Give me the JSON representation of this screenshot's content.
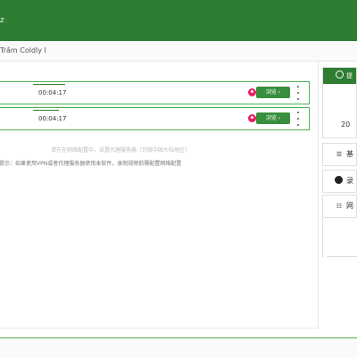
{
  "header": {
    "title_fragment": "z"
  },
  "breadcrumb": {
    "text": "Trầm Coldly I"
  },
  "tracks": [
    {
      "progress": 0.85,
      "time": "00:04:17",
      "action_label": "浏览 ›"
    },
    {
      "progress": 0.7,
      "time": "00:04:17",
      "action_label": "浏览 ›"
    }
  ],
  "hints": {
    "line1": "请在在网络配置中，设置代理服务器（只限中国大陆地区）",
    "line2": "提示：如果使用VPN或者代理服务器使用本软件，录制视频前需配置网络配置"
  },
  "sidebar": {
    "header_label": "提",
    "number_fragment": "20",
    "items": [
      {
        "icon": "database-icon",
        "label": "基"
      },
      {
        "icon": "dark-circle-icon",
        "label": "录"
      },
      {
        "icon": "network-icon",
        "label": "网"
      }
    ]
  },
  "colors": {
    "primary": "#2e7d32",
    "button": "#388e3c",
    "accent_pink": "#e91e63"
  }
}
